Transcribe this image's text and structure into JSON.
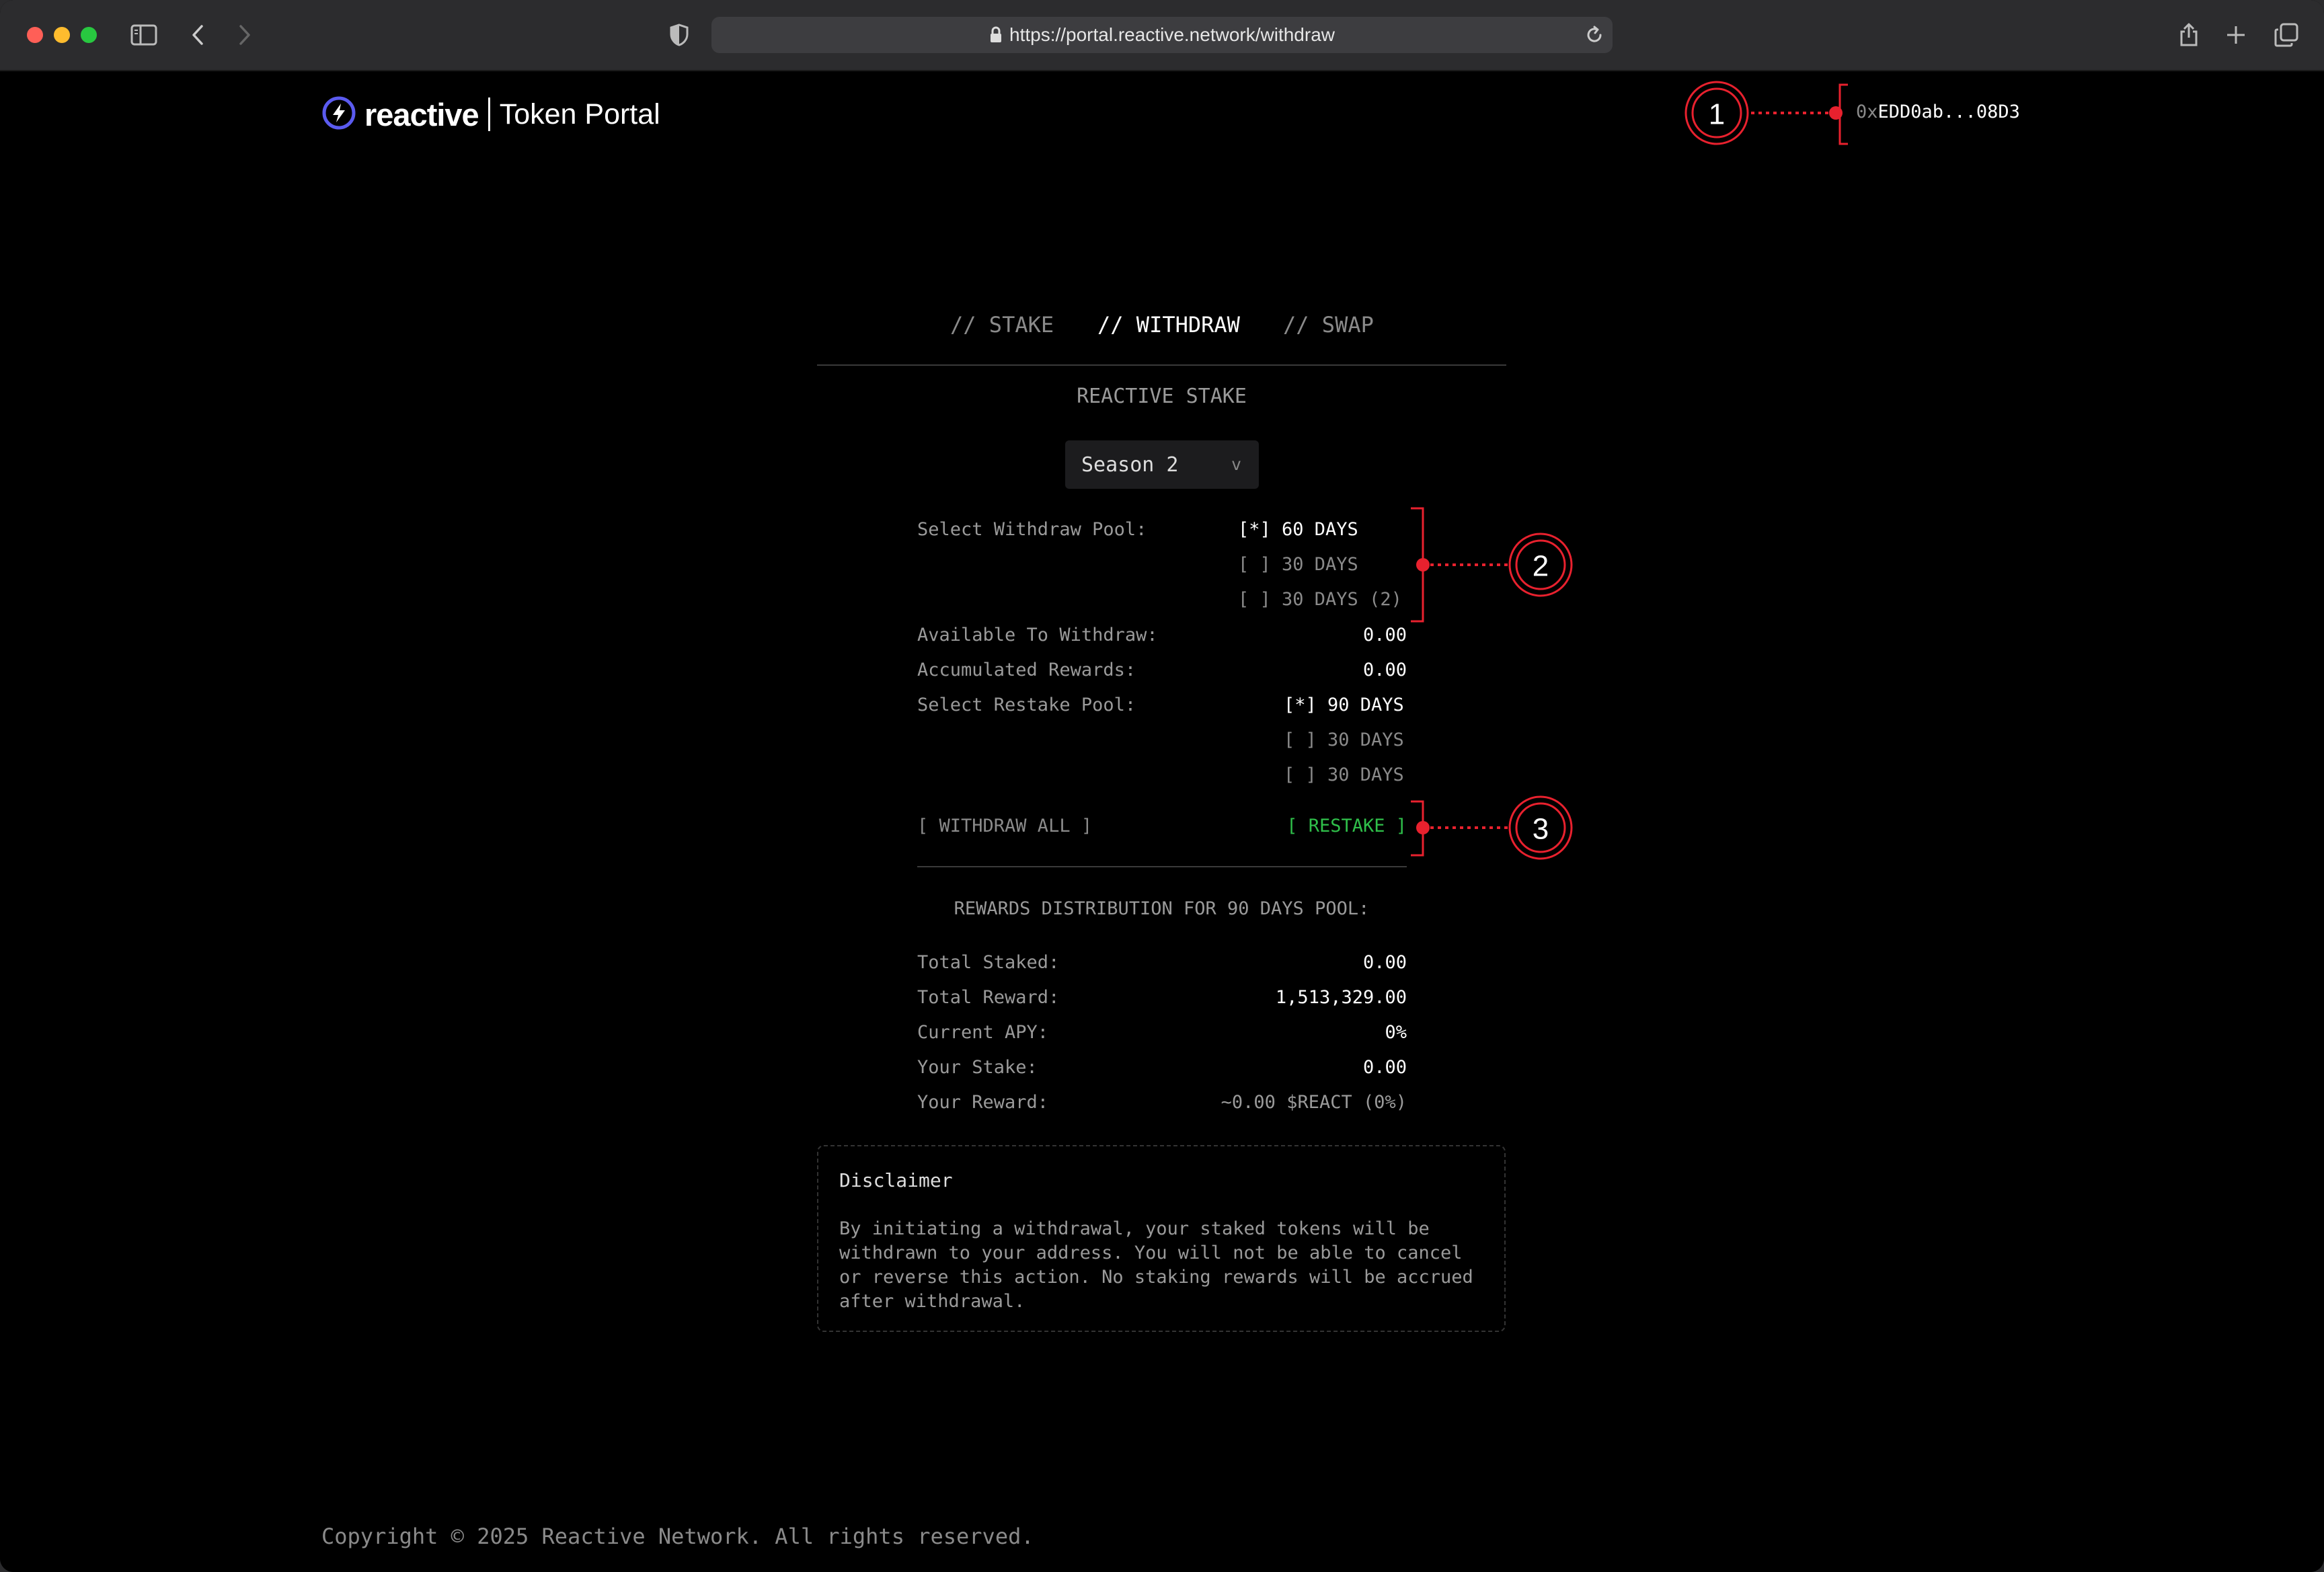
{
  "browser": {
    "url": "https://portal.reactive.network/withdraw"
  },
  "header": {
    "logo_word": "reactive",
    "portal_title": "Token Portal",
    "wallet_prefix": "0x",
    "wallet_address": "EDD0ab...08D3"
  },
  "tabs": [
    {
      "label": "// STAKE",
      "active": false
    },
    {
      "label": "// WITHDRAW",
      "active": true
    },
    {
      "label": "// SWAP",
      "active": false
    }
  ],
  "section_title": "REACTIVE STAKE",
  "season_select": {
    "value": "Season 2",
    "chevron": "v"
  },
  "withdraw_form": {
    "withdraw_pool_label": "Select Withdraw Pool:",
    "withdraw_pools": [
      {
        "text": "[*] 60 DAYS",
        "selected": true
      },
      {
        "text": "[ ] 30 DAYS",
        "selected": false
      },
      {
        "text": "[ ] 30 DAYS (2)",
        "selected": false
      }
    ],
    "available_label": "Available To Withdraw:",
    "available_value": "0.00",
    "accumulated_label": "Accumulated Rewards:",
    "accumulated_value": "0.00",
    "restake_pool_label": "Select Restake Pool:",
    "restake_pools": [
      {
        "text": "[*] 90 DAYS",
        "selected": true
      },
      {
        "text": "[ ] 30 DAYS",
        "selected": false
      },
      {
        "text": "[ ] 30 DAYS",
        "selected": false
      }
    ],
    "withdraw_all_label": "[ WITHDRAW ALL ]",
    "restake_label": "[ RESTAKE ]"
  },
  "rewards": {
    "title": "REWARDS DISTRIBUTION FOR 90 DAYS POOL:",
    "total_staked_label": "Total Staked:",
    "total_staked_value": "0.00",
    "total_reward_label": "Total Reward:",
    "total_reward_value": "1,513,329.00",
    "current_apy_label": "Current APY:",
    "current_apy_value": "0%",
    "your_stake_label": "Your Stake:",
    "your_stake_value": "0.00",
    "your_reward_label": "Your Reward:",
    "your_reward_value": "~0.00 $REACT (0%)"
  },
  "disclaimer": {
    "title": "Disclaimer",
    "body": "By initiating a withdrawal, your staked tokens will be withdrawn to your address. You will not be able to cancel or reverse this action. No staking rewards will be accrued after withdrawal."
  },
  "footer": {
    "copyright": "Copyright © 2025 Reactive Network. All rights reserved."
  },
  "annotations": {
    "callout_1": "1",
    "callout_2": "2",
    "callout_3": "3",
    "color": "#e8212e"
  },
  "colors": {
    "accent_green": "#2fbf4a",
    "brand_purple": "#5b5bf0",
    "background": "#000000"
  }
}
